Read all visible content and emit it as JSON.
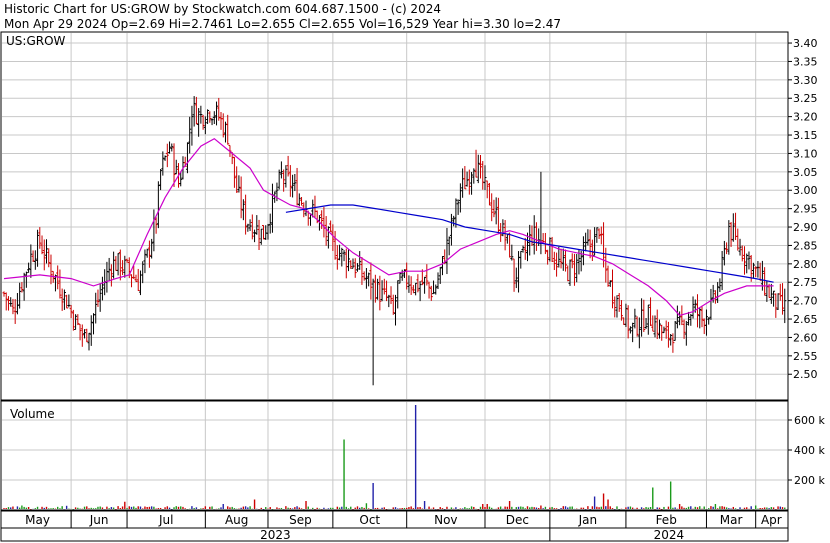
{
  "header": {
    "line1": "Historic Chart for US:GROW by Stockwatch.com 604.687.1500 - (c) 2024",
    "line2": "Mon Apr 29 2024  Op=2.69  Hi=2.7461  Lo=2.655  Cl=2.655  Vol=16,529  Year hi=3.30  lo=2.47"
  },
  "chart_data": [
    {
      "type": "ohlc",
      "title": "US:GROW",
      "ylim": [
        2.43,
        3.43
      ],
      "y_ticks": [
        "3.40",
        "3.35",
        "3.30",
        "3.25",
        "3.20",
        "3.15",
        "3.10",
        "3.05",
        "3.00",
        "2.95",
        "2.90",
        "2.85",
        "2.80",
        "2.75",
        "2.70",
        "2.65",
        "2.60",
        "2.55",
        "2.50"
      ],
      "x_month_labels": [
        "May",
        "Jun",
        "Jul",
        "Aug",
        "Sep",
        "Oct",
        "Nov",
        "Dec",
        "Jan",
        "Feb",
        "Mar",
        "Apr"
      ],
      "x_year_labels": [
        "2023",
        "2024"
      ],
      "grid": true,
      "colors": {
        "up": "#000000",
        "down": "#cc0000",
        "ma_short": "#cc00cc",
        "ma_long": "#0000cc",
        "grid": "#c8c8c8"
      },
      "close_path": [
        [
          0,
          2.72
        ],
        [
          4,
          2.67
        ],
        [
          8,
          2.75
        ],
        [
          12,
          2.82
        ],
        [
          16,
          2.86
        ],
        [
          20,
          2.8
        ],
        [
          24,
          2.75
        ],
        [
          28,
          2.7
        ],
        [
          32,
          2.64
        ],
        [
          36,
          2.6
        ],
        [
          40,
          2.66
        ],
        [
          44,
          2.74
        ],
        [
          48,
          2.8
        ],
        [
          52,
          2.8
        ],
        [
          56,
          2.78
        ],
        [
          60,
          2.75
        ],
        [
          64,
          2.82
        ],
        [
          68,
          2.92
        ],
        [
          70,
          3.05
        ],
        [
          74,
          3.12
        ],
        [
          78,
          3.02
        ],
        [
          82,
          3.12
        ],
        [
          84,
          3.22
        ],
        [
          88,
          3.2
        ],
        [
          92,
          3.22
        ],
        [
          96,
          3.2
        ],
        [
          100,
          3.15
        ],
        [
          104,
          3.0
        ],
        [
          108,
          2.92
        ],
        [
          112,
          2.9
        ],
        [
          116,
          2.88
        ],
        [
          120,
          2.96
        ],
        [
          124,
          3.04
        ],
        [
          128,
          3.02
        ],
        [
          132,
          2.98
        ],
        [
          136,
          2.95
        ],
        [
          140,
          2.93
        ],
        [
          144,
          2.88
        ],
        [
          148,
          2.84
        ],
        [
          152,
          2.82
        ],
        [
          156,
          2.8
        ],
        [
          160,
          2.77
        ],
        [
          164,
          2.75
        ],
        [
          168,
          2.72
        ],
        [
          172,
          2.7
        ],
        [
          174,
          2.66
        ],
        [
          176,
          2.74
        ],
        [
          180,
          2.76
        ],
        [
          184,
          2.74
        ],
        [
          188,
          2.75
        ],
        [
          192,
          2.72
        ],
        [
          196,
          2.8
        ],
        [
          200,
          2.9
        ],
        [
          204,
          3.0
        ],
        [
          208,
          3.04
        ],
        [
          210,
          3.08
        ],
        [
          214,
          3.02
        ],
        [
          218,
          2.96
        ],
        [
          222,
          2.9
        ],
        [
          226,
          2.84
        ],
        [
          228,
          2.76
        ],
        [
          232,
          2.82
        ],
        [
          236,
          2.88
        ],
        [
          240,
          2.86
        ],
        [
          244,
          2.84
        ],
        [
          248,
          2.8
        ],
        [
          252,
          2.78
        ],
        [
          256,
          2.8
        ],
        [
          260,
          2.84
        ],
        [
          264,
          2.86
        ],
        [
          266,
          2.9
        ],
        [
          268,
          2.8
        ],
        [
          272,
          2.72
        ],
        [
          276,
          2.68
        ],
        [
          280,
          2.62
        ],
        [
          284,
          2.64
        ],
        [
          288,
          2.66
        ],
        [
          292,
          2.63
        ],
        [
          296,
          2.6
        ],
        [
          300,
          2.62
        ],
        [
          304,
          2.64
        ],
        [
          308,
          2.68
        ],
        [
          312,
          2.65
        ],
        [
          316,
          2.68
        ],
        [
          320,
          2.75
        ],
        [
          324,
          2.9
        ],
        [
          328,
          2.85
        ],
        [
          332,
          2.82
        ],
        [
          336,
          2.78
        ],
        [
          340,
          2.74
        ],
        [
          344,
          2.7
        ],
        [
          348,
          2.68
        ]
      ],
      "ma_short": [
        [
          0,
          2.76
        ],
        [
          16,
          2.77
        ],
        [
          30,
          2.76
        ],
        [
          40,
          2.74
        ],
        [
          50,
          2.76
        ],
        [
          56,
          2.77
        ],
        [
          64,
          2.88
        ],
        [
          72,
          2.98
        ],
        [
          80,
          3.06
        ],
        [
          88,
          3.12
        ],
        [
          94,
          3.14
        ],
        [
          102,
          3.1
        ],
        [
          110,
          3.06
        ],
        [
          116,
          3.0
        ],
        [
          122,
          2.98
        ],
        [
          128,
          2.96
        ],
        [
          134,
          2.95
        ],
        [
          140,
          2.92
        ],
        [
          148,
          2.87
        ],
        [
          156,
          2.83
        ],
        [
          164,
          2.8
        ],
        [
          172,
          2.77
        ],
        [
          180,
          2.78
        ],
        [
          188,
          2.78
        ],
        [
          196,
          2.8
        ],
        [
          204,
          2.84
        ],
        [
          212,
          2.86
        ],
        [
          220,
          2.88
        ],
        [
          226,
          2.89
        ],
        [
          232,
          2.88
        ],
        [
          240,
          2.86
        ],
        [
          248,
          2.84
        ],
        [
          256,
          2.83
        ],
        [
          264,
          2.82
        ],
        [
          272,
          2.8
        ],
        [
          280,
          2.77
        ],
        [
          288,
          2.74
        ],
        [
          296,
          2.7
        ],
        [
          302,
          2.66
        ],
        [
          308,
          2.67
        ],
        [
          316,
          2.7
        ],
        [
          322,
          2.72
        ],
        [
          332,
          2.74
        ],
        [
          344,
          2.74
        ]
      ],
      "ma_long": [
        [
          126,
          2.94
        ],
        [
          136,
          2.95
        ],
        [
          146,
          2.96
        ],
        [
          156,
          2.96
        ],
        [
          166,
          2.95
        ],
        [
          176,
          2.94
        ],
        [
          186,
          2.93
        ],
        [
          196,
          2.92
        ],
        [
          206,
          2.9
        ],
        [
          216,
          2.89
        ],
        [
          226,
          2.88
        ],
        [
          236,
          2.86
        ],
        [
          246,
          2.85
        ],
        [
          256,
          2.84
        ],
        [
          266,
          2.83
        ],
        [
          276,
          2.82
        ],
        [
          286,
          2.81
        ],
        [
          296,
          2.8
        ],
        [
          306,
          2.79
        ],
        [
          316,
          2.78
        ],
        [
          326,
          2.77
        ],
        [
          336,
          2.76
        ],
        [
          344,
          2.75
        ]
      ],
      "spikes": [
        {
          "i": 165,
          "lo": 2.47
        },
        {
          "i": 211,
          "hi": 3.11
        },
        {
          "i": 240,
          "hi": 3.05
        }
      ]
    },
    {
      "type": "bar",
      "title": "Volume",
      "y_ticks": [
        "600 k",
        "400 k",
        "200 k"
      ],
      "ylim": [
        0,
        700
      ],
      "big_bars": [
        {
          "i": 8,
          "v": 30
        },
        {
          "i": 28,
          "v": 28
        },
        {
          "i": 54,
          "v": 55
        },
        {
          "i": 98,
          "v": 40
        },
        {
          "i": 112,
          "v": 70
        },
        {
          "i": 135,
          "v": 60
        },
        {
          "i": 152,
          "v": 470
        },
        {
          "i": 162,
          "v": 45
        },
        {
          "i": 165,
          "v": 180
        },
        {
          "i": 184,
          "v": 700
        },
        {
          "i": 188,
          "v": 60
        },
        {
          "i": 214,
          "v": 40
        },
        {
          "i": 216,
          "v": 40
        },
        {
          "i": 226,
          "v": 60
        },
        {
          "i": 240,
          "v": 30
        },
        {
          "i": 264,
          "v": 90
        },
        {
          "i": 268,
          "v": 110
        },
        {
          "i": 270,
          "v": 70
        },
        {
          "i": 290,
          "v": 150
        },
        {
          "i": 298,
          "v": 190
        },
        {
          "i": 302,
          "v": 40
        },
        {
          "i": 318,
          "v": 40
        },
        {
          "i": 336,
          "v": 30
        }
      ]
    }
  ]
}
